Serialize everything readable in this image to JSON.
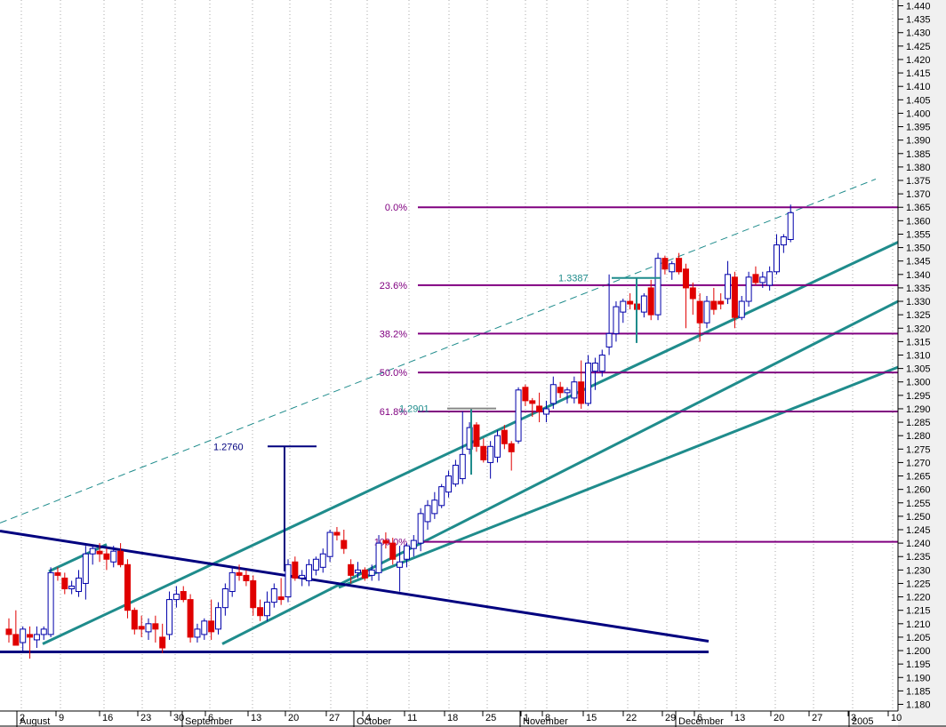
{
  "chart_data": {
    "type": "candlestick",
    "title": "",
    "y_axis": {
      "side": "right",
      "range": [
        1.1768,
        1.4422
      ],
      "ticks": [
        "1.440",
        "1.435",
        "1.430",
        "1.425",
        "1.420",
        "1.415",
        "1.410",
        "1.405",
        "1.400",
        "1.395",
        "1.390",
        "1.385",
        "1.380",
        "1.375",
        "1.370",
        "1.365",
        "1.360",
        "1.355",
        "1.350",
        "1.345",
        "1.340",
        "1.335",
        "1.330",
        "1.325",
        "1.320",
        "1.315",
        "1.310",
        "1.305",
        "1.300",
        "1.295",
        "1.290",
        "1.285",
        "1.280",
        "1.275",
        "1.270",
        "1.265",
        "1.260",
        "1.255",
        "1.250",
        "1.245",
        "1.240",
        "1.235",
        "1.230",
        "1.225",
        "1.220",
        "1.215",
        "1.210",
        "1.205",
        "1.200",
        "1.195",
        "1.190",
        "1.185",
        "1.180"
      ]
    },
    "x_axis": {
      "day_ticks": [
        "2",
        "9",
        "16",
        "23",
        "30",
        "6",
        "13",
        "20",
        "27",
        "4",
        "11",
        "18",
        "25",
        "1",
        "8",
        "15",
        "22",
        "29",
        "6",
        "13",
        "20",
        "27",
        "3",
        "10"
      ],
      "months": [
        "August",
        "September",
        "October",
        "November",
        "December",
        "2005"
      ]
    },
    "grid": "vertical-dotted",
    "candles": [
      {
        "o": 1.208,
        "h": 1.212,
        "l": 1.203,
        "c": 1.206,
        "dir": "down"
      },
      {
        "o": 1.206,
        "h": 1.215,
        "l": 1.203,
        "c": 1.202,
        "dir": "down"
      },
      {
        "o": 1.203,
        "h": 1.209,
        "l": 1.2,
        "c": 1.208,
        "dir": "up"
      },
      {
        "o": 1.206,
        "h": 1.209,
        "l": 1.197,
        "c": 1.205,
        "dir": "down"
      },
      {
        "o": 1.204,
        "h": 1.209,
        "l": 1.201,
        "c": 1.206,
        "dir": "up"
      },
      {
        "o": 1.206,
        "h": 1.209,
        "l": 1.204,
        "c": 1.208,
        "dir": "up"
      },
      {
        "o": 1.206,
        "h": 1.231,
        "l": 1.205,
        "c": 1.229,
        "dir": "up"
      },
      {
        "o": 1.229,
        "h": 1.231,
        "l": 1.226,
        "c": 1.228,
        "dir": "down"
      },
      {
        "o": 1.227,
        "h": 1.229,
        "l": 1.221,
        "c": 1.223,
        "dir": "down"
      },
      {
        "o": 1.223,
        "h": 1.226,
        "l": 1.221,
        "c": 1.224,
        "dir": "up"
      },
      {
        "o": 1.222,
        "h": 1.23,
        "l": 1.22,
        "c": 1.227,
        "dir": "up"
      },
      {
        "o": 1.225,
        "h": 1.239,
        "l": 1.219,
        "c": 1.236,
        "dir": "up"
      },
      {
        "o": 1.236,
        "h": 1.239,
        "l": 1.232,
        "c": 1.238,
        "dir": "up"
      },
      {
        "o": 1.237,
        "h": 1.24,
        "l": 1.233,
        "c": 1.236,
        "dir": "down"
      },
      {
        "o": 1.236,
        "h": 1.238,
        "l": 1.23,
        "c": 1.234,
        "dir": "down"
      },
      {
        "o": 1.233,
        "h": 1.239,
        "l": 1.231,
        "c": 1.237,
        "dir": "up"
      },
      {
        "o": 1.237,
        "h": 1.24,
        "l": 1.231,
        "c": 1.232,
        "dir": "down"
      },
      {
        "o": 1.232,
        "h": 1.234,
        "l": 1.212,
        "c": 1.215,
        "dir": "down"
      },
      {
        "o": 1.215,
        "h": 1.216,
        "l": 1.206,
        "c": 1.208,
        "dir": "down"
      },
      {
        "o": 1.208,
        "h": 1.213,
        "l": 1.205,
        "c": 1.209,
        "dir": "down"
      },
      {
        "o": 1.207,
        "h": 1.212,
        "l": 1.204,
        "c": 1.21,
        "dir": "up"
      },
      {
        "o": 1.21,
        "h": 1.213,
        "l": 1.203,
        "c": 1.208,
        "dir": "down"
      },
      {
        "o": 1.205,
        "h": 1.21,
        "l": 1.199,
        "c": 1.201,
        "dir": "down"
      },
      {
        "o": 1.206,
        "h": 1.222,
        "l": 1.204,
        "c": 1.219,
        "dir": "up"
      },
      {
        "o": 1.219,
        "h": 1.224,
        "l": 1.216,
        "c": 1.221,
        "dir": "up"
      },
      {
        "o": 1.222,
        "h": 1.224,
        "l": 1.218,
        "c": 1.219,
        "dir": "down"
      },
      {
        "o": 1.219,
        "h": 1.221,
        "l": 1.203,
        "c": 1.205,
        "dir": "down"
      },
      {
        "o": 1.205,
        "h": 1.21,
        "l": 1.203,
        "c": 1.208,
        "dir": "up"
      },
      {
        "o": 1.206,
        "h": 1.212,
        "l": 1.204,
        "c": 1.211,
        "dir": "up"
      },
      {
        "o": 1.211,
        "h": 1.219,
        "l": 1.204,
        "c": 1.207,
        "dir": "down"
      },
      {
        "o": 1.208,
        "h": 1.218,
        "l": 1.206,
        "c": 1.216,
        "dir": "up"
      },
      {
        "o": 1.216,
        "h": 1.225,
        "l": 1.213,
        "c": 1.223,
        "dir": "up"
      },
      {
        "o": 1.222,
        "h": 1.231,
        "l": 1.22,
        "c": 1.229,
        "dir": "up"
      },
      {
        "o": 1.229,
        "h": 1.232,
        "l": 1.226,
        "c": 1.228,
        "dir": "down"
      },
      {
        "o": 1.228,
        "h": 1.23,
        "l": 1.224,
        "c": 1.226,
        "dir": "down"
      },
      {
        "o": 1.226,
        "h": 1.228,
        "l": 1.213,
        "c": 1.216,
        "dir": "down"
      },
      {
        "o": 1.216,
        "h": 1.219,
        "l": 1.211,
        "c": 1.213,
        "dir": "down"
      },
      {
        "o": 1.213,
        "h": 1.222,
        "l": 1.211,
        "c": 1.218,
        "dir": "up"
      },
      {
        "o": 1.218,
        "h": 1.225,
        "l": 1.216,
        "c": 1.223,
        "dir": "up"
      },
      {
        "o": 1.22,
        "h": 1.227,
        "l": 1.217,
        "c": 1.219,
        "dir": "down"
      },
      {
        "o": 1.22,
        "h": 1.234,
        "l": 1.218,
        "c": 1.232,
        "dir": "up"
      },
      {
        "o": 1.233,
        "h": 1.235,
        "l": 1.226,
        "c": 1.227,
        "dir": "down"
      },
      {
        "o": 1.227,
        "h": 1.23,
        "l": 1.224,
        "c": 1.228,
        "dir": "up"
      },
      {
        "o": 1.226,
        "h": 1.234,
        "l": 1.224,
        "c": 1.232,
        "dir": "up"
      },
      {
        "o": 1.23,
        "h": 1.235,
        "l": 1.228,
        "c": 1.234,
        "dir": "up"
      },
      {
        "o": 1.231,
        "h": 1.238,
        "l": 1.229,
        "c": 1.236,
        "dir": "up"
      },
      {
        "o": 1.235,
        "h": 1.245,
        "l": 1.233,
        "c": 1.244,
        "dir": "up"
      },
      {
        "o": 1.244,
        "h": 1.246,
        "l": 1.241,
        "c": 1.243,
        "dir": "down"
      },
      {
        "o": 1.241,
        "h": 1.245,
        "l": 1.236,
        "c": 1.238,
        "dir": "down"
      },
      {
        "o": 1.232,
        "h": 1.234,
        "l": 1.225,
        "c": 1.228,
        "dir": "down"
      },
      {
        "o": 1.229,
        "h": 1.233,
        "l": 1.227,
        "c": 1.23,
        "dir": "up"
      },
      {
        "o": 1.23,
        "h": 1.231,
        "l": 1.226,
        "c": 1.227,
        "dir": "down"
      },
      {
        "o": 1.228,
        "h": 1.232,
        "l": 1.226,
        "c": 1.23,
        "dir": "up"
      },
      {
        "o": 1.229,
        "h": 1.243,
        "l": 1.226,
        "c": 1.24,
        "dir": "up"
      },
      {
        "o": 1.241,
        "h": 1.244,
        "l": 1.238,
        "c": 1.24,
        "dir": "down"
      },
      {
        "o": 1.24,
        "h": 1.242,
        "l": 1.232,
        "c": 1.234,
        "dir": "down"
      },
      {
        "o": 1.231,
        "h": 1.239,
        "l": 1.222,
        "c": 1.233,
        "dir": "up"
      },
      {
        "o": 1.234,
        "h": 1.24,
        "l": 1.231,
        "c": 1.239,
        "dir": "up"
      },
      {
        "o": 1.238,
        "h": 1.243,
        "l": 1.235,
        "c": 1.241,
        "dir": "up"
      },
      {
        "o": 1.24,
        "h": 1.253,
        "l": 1.237,
        "c": 1.251,
        "dir": "up"
      },
      {
        "o": 1.248,
        "h": 1.256,
        "l": 1.245,
        "c": 1.254,
        "dir": "up"
      },
      {
        "o": 1.251,
        "h": 1.259,
        "l": 1.249,
        "c": 1.256,
        "dir": "up"
      },
      {
        "o": 1.254,
        "h": 1.262,
        "l": 1.253,
        "c": 1.261,
        "dir": "up"
      },
      {
        "o": 1.259,
        "h": 1.267,
        "l": 1.257,
        "c": 1.265,
        "dir": "up"
      },
      {
        "o": 1.262,
        "h": 1.271,
        "l": 1.261,
        "c": 1.269,
        "dir": "up"
      },
      {
        "o": 1.264,
        "h": 1.289,
        "l": 1.262,
        "c": 1.273,
        "dir": "up"
      },
      {
        "o": 1.275,
        "h": 1.285,
        "l": 1.273,
        "c": 1.283,
        "dir": "up"
      },
      {
        "o": 1.284,
        "h": 1.285,
        "l": 1.274,
        "c": 1.276,
        "dir": "down"
      },
      {
        "o": 1.276,
        "h": 1.279,
        "l": 1.27,
        "c": 1.271,
        "dir": "down"
      },
      {
        "o": 1.27,
        "h": 1.278,
        "l": 1.264,
        "c": 1.276,
        "dir": "up"
      },
      {
        "o": 1.272,
        "h": 1.282,
        "l": 1.27,
        "c": 1.28,
        "dir": "up"
      },
      {
        "o": 1.282,
        "h": 1.284,
        "l": 1.275,
        "c": 1.277,
        "dir": "down"
      },
      {
        "o": 1.277,
        "h": 1.278,
        "l": 1.267,
        "c": 1.274,
        "dir": "down"
      },
      {
        "o": 1.278,
        "h": 1.298,
        "l": 1.277,
        "c": 1.297,
        "dir": "up"
      },
      {
        "o": 1.298,
        "h": 1.299,
        "l": 1.291,
        "c": 1.293,
        "dir": "down"
      },
      {
        "o": 1.293,
        "h": 1.294,
        "l": 1.287,
        "c": 1.292,
        "dir": "down"
      },
      {
        "o": 1.291,
        "h": 1.296,
        "l": 1.285,
        "c": 1.289,
        "dir": "down"
      },
      {
        "o": 1.288,
        "h": 1.293,
        "l": 1.285,
        "c": 1.29,
        "dir": "up"
      },
      {
        "o": 1.292,
        "h": 1.302,
        "l": 1.29,
        "c": 1.299,
        "dir": "up"
      },
      {
        "o": 1.298,
        "h": 1.3,
        "l": 1.294,
        "c": 1.296,
        "dir": "down"
      },
      {
        "o": 1.296,
        "h": 1.298,
        "l": 1.292,
        "c": 1.297,
        "dir": "up"
      },
      {
        "o": 1.294,
        "h": 1.302,
        "l": 1.292,
        "c": 1.3,
        "dir": "up"
      },
      {
        "o": 1.3,
        "h": 1.308,
        "l": 1.29,
        "c": 1.292,
        "dir": "down"
      },
      {
        "o": 1.292,
        "h": 1.31,
        "l": 1.291,
        "c": 1.307,
        "dir": "up"
      },
      {
        "o": 1.304,
        "h": 1.309,
        "l": 1.297,
        "c": 1.307,
        "dir": "up"
      },
      {
        "o": 1.304,
        "h": 1.312,
        "l": 1.302,
        "c": 1.31,
        "dir": "up"
      },
      {
        "o": 1.313,
        "h": 1.34,
        "l": 1.31,
        "c": 1.318,
        "dir": "up"
      },
      {
        "o": 1.318,
        "h": 1.33,
        "l": 1.315,
        "c": 1.328,
        "dir": "up"
      },
      {
        "o": 1.326,
        "h": 1.331,
        "l": 1.322,
        "c": 1.33,
        "dir": "up"
      },
      {
        "o": 1.33,
        "h": 1.333,
        "l": 1.327,
        "c": 1.329,
        "dir": "down"
      },
      {
        "o": 1.329,
        "h": 1.333,
        "l": 1.326,
        "c": 1.327,
        "dir": "down"
      },
      {
        "o": 1.326,
        "h": 1.333,
        "l": 1.324,
        "c": 1.332,
        "dir": "up"
      },
      {
        "o": 1.335,
        "h": 1.338,
        "l": 1.323,
        "c": 1.325,
        "dir": "down"
      },
      {
        "o": 1.325,
        "h": 1.348,
        "l": 1.323,
        "c": 1.346,
        "dir": "up"
      },
      {
        "o": 1.346,
        "h": 1.347,
        "l": 1.34,
        "c": 1.342,
        "dir": "down"
      },
      {
        "o": 1.341,
        "h": 1.345,
        "l": 1.338,
        "c": 1.344,
        "dir": "up"
      },
      {
        "o": 1.346,
        "h": 1.348,
        "l": 1.34,
        "c": 1.341,
        "dir": "down"
      },
      {
        "o": 1.342,
        "h": 1.344,
        "l": 1.32,
        "c": 1.335,
        "dir": "down"
      },
      {
        "o": 1.335,
        "h": 1.337,
        "l": 1.325,
        "c": 1.331,
        "dir": "down"
      },
      {
        "o": 1.33,
        "h": 1.333,
        "l": 1.315,
        "c": 1.322,
        "dir": "down"
      },
      {
        "o": 1.322,
        "h": 1.332,
        "l": 1.32,
        "c": 1.33,
        "dir": "up"
      },
      {
        "o": 1.33,
        "h": 1.335,
        "l": 1.325,
        "c": 1.327,
        "dir": "down"
      },
      {
        "o": 1.33,
        "h": 1.333,
        "l": 1.327,
        "c": 1.329,
        "dir": "down"
      },
      {
        "o": 1.331,
        "h": 1.345,
        "l": 1.329,
        "c": 1.34,
        "dir": "up"
      },
      {
        "o": 1.339,
        "h": 1.341,
        "l": 1.32,
        "c": 1.324,
        "dir": "down"
      },
      {
        "o": 1.324,
        "h": 1.332,
        "l": 1.323,
        "c": 1.33,
        "dir": "up"
      },
      {
        "o": 1.33,
        "h": 1.341,
        "l": 1.328,
        "c": 1.339,
        "dir": "up"
      },
      {
        "o": 1.34,
        "h": 1.343,
        "l": 1.336,
        "c": 1.337,
        "dir": "down"
      },
      {
        "o": 1.337,
        "h": 1.341,
        "l": 1.335,
        "c": 1.339,
        "dir": "up"
      },
      {
        "o": 1.336,
        "h": 1.343,
        "l": 1.334,
        "c": 1.341,
        "dir": "up"
      },
      {
        "o": 1.341,
        "h": 1.355,
        "l": 1.34,
        "c": 1.351,
        "dir": "up"
      },
      {
        "o": 1.351,
        "h": 1.355,
        "l": 1.348,
        "c": 1.354,
        "dir": "up"
      },
      {
        "o": 1.353,
        "h": 1.366,
        "l": 1.352,
        "c": 1.363,
        "dir": "up"
      }
    ],
    "fibonacci": [
      {
        "label": "0.0%",
        "price": 1.365
      },
      {
        "label": "23.6%",
        "price": 1.336
      },
      {
        "label": "38.2%",
        "price": 1.318
      },
      {
        "label": "50.0%",
        "price": 1.3035
      },
      {
        "label": "61.8%",
        "price": 1.289
      },
      {
        "label": "100.0%",
        "price": 1.2405
      }
    ],
    "annotations": [
      {
        "label": "1.2760",
        "price": 1.276
      },
      {
        "label": "1.2901",
        "price": 1.2901
      },
      {
        "label": "1.3387",
        "price": 1.3387
      }
    ],
    "trendlines": [
      {
        "kind": "channel",
        "color": "teal",
        "from": [
          1.2025
        ],
        "to": [
          1.352
        ]
      },
      {
        "kind": "channel",
        "color": "teal",
        "from": [
          1.2025
        ],
        "to": [
          1.33
        ]
      },
      {
        "kind": "channel",
        "color": "teal",
        "from": [
          1.2025
        ],
        "to": [
          1.3055
        ]
      },
      {
        "kind": "resistance",
        "color": "navy",
        "from": [
          1.2445
        ],
        "to": [
          1.2035
        ]
      },
      {
        "kind": "support",
        "color": "navy",
        "price": 1.1995
      },
      {
        "kind": "dashed-parallel",
        "color": "teal",
        "from": [
          1.2475
        ],
        "to": [
          1.3755
        ]
      }
    ],
    "colors": {
      "up_body": "#ffffff",
      "up_wick": "#0000aa",
      "down_body": "#e00000",
      "fib": "#800080",
      "channel": "#1f8c8c",
      "navy": "#00007f",
      "grid": "#aaaaaa",
      "axis_bg": "#f0f0f0"
    }
  }
}
